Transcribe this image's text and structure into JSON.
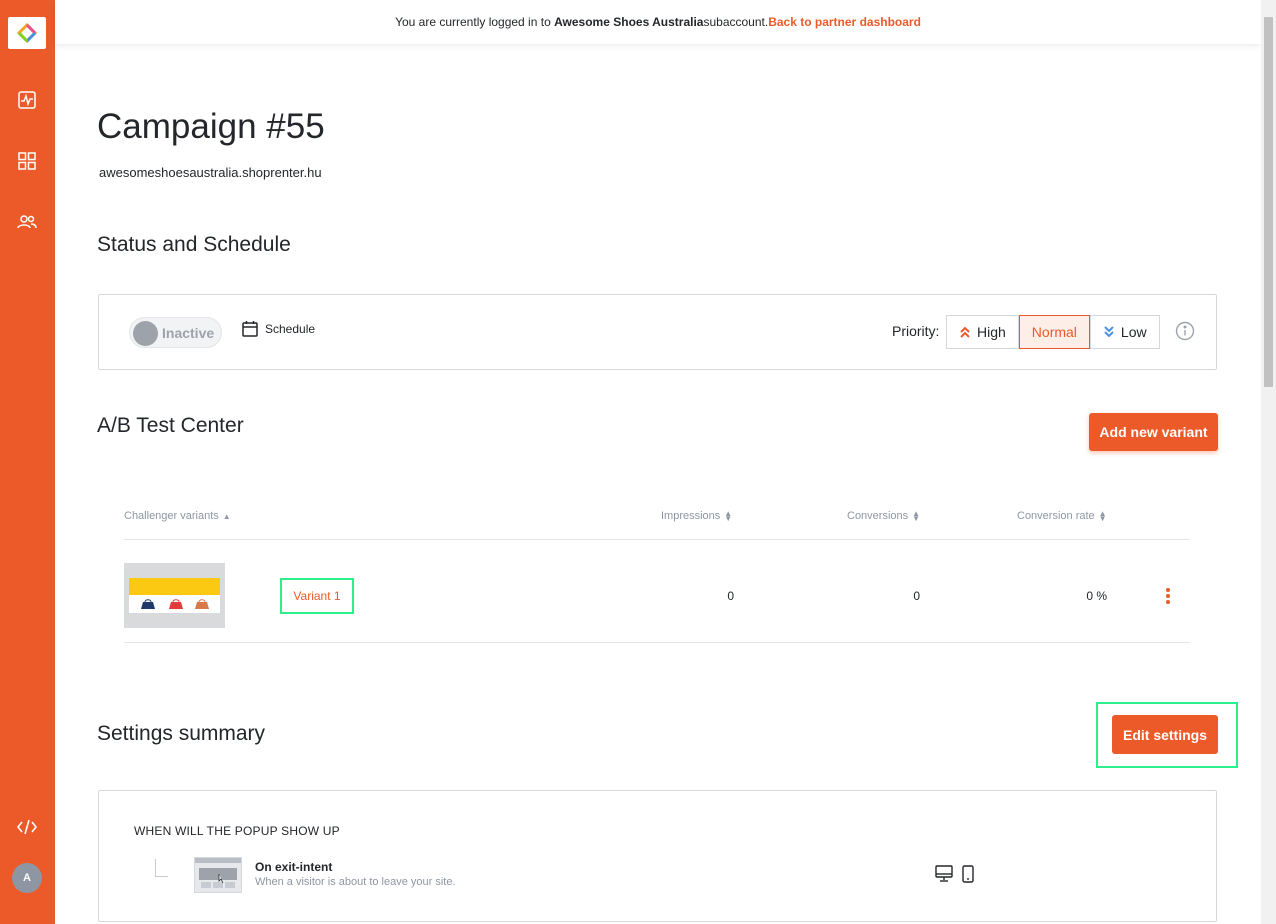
{
  "sidebar": {
    "items": [
      {
        "icon": "analytics-icon"
      },
      {
        "icon": "grid-icon"
      },
      {
        "icon": "users-icon"
      }
    ],
    "code_icon": "code-icon",
    "avatar_initial": "A",
    "accent": "#ed5a29"
  },
  "topbar": {
    "prefix": "You are currently logged in to ",
    "account": "Awesome Shoes Australia",
    "suffix": " subaccount.",
    "link": "Back to partner dashboard"
  },
  "header": {
    "title": "Campaign #55",
    "domain": "awesomeshoesaustralia.shoprenter.hu"
  },
  "status": {
    "heading": "Status and Schedule",
    "toggle_label": "Inactive",
    "schedule_label": "Schedule",
    "priority_label": "Priority:",
    "priority_options": [
      "High",
      "Normal",
      "Low"
    ],
    "priority_selected": "Normal"
  },
  "ab": {
    "heading": "A/B Test Center",
    "add_button": "Add new variant",
    "columns": [
      "Challenger variants",
      "Impressions",
      "Conversions",
      "Conversion rate"
    ],
    "rows": [
      {
        "name": "Variant 1",
        "impressions": "0",
        "conversions": "0",
        "rate": "0 %"
      }
    ]
  },
  "settings": {
    "heading": "Settings summary",
    "edit_button": "Edit settings",
    "section_title": "WHEN WILL THE POPUP SHOW UP",
    "trigger_title": "On exit-intent",
    "trigger_desc": "When a visitor is about to leave your site."
  }
}
